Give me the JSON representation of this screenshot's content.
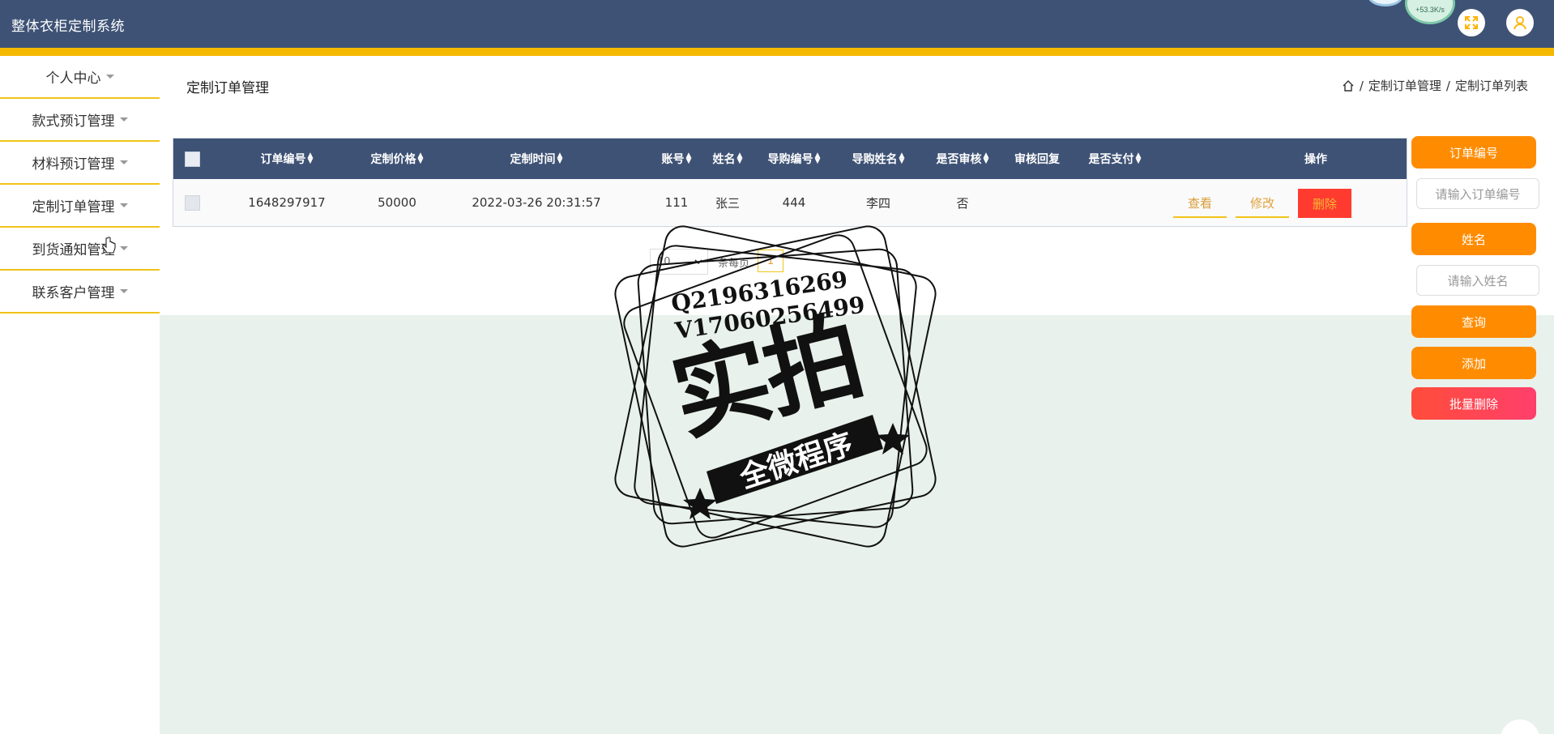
{
  "app": {
    "title": "整体衣柜定制系统"
  },
  "header": {
    "net_speed": "+53.3K/s"
  },
  "sidebar": {
    "items": [
      {
        "label": "个人中心"
      },
      {
        "label": "款式预订管理"
      },
      {
        "label": "材料预订管理"
      },
      {
        "label": "定制订单管理"
      },
      {
        "label": "到货通知管理"
      },
      {
        "label": "联系客户管理"
      }
    ]
  },
  "page": {
    "title": "定制订单管理"
  },
  "breadcrumb": {
    "items": [
      "定制订单管理",
      "定制订单列表"
    ],
    "separator": "/"
  },
  "table": {
    "columns": [
      "订单编号",
      "定制价格",
      "定制时间",
      "账号",
      "姓名",
      "导购编号",
      "导购姓名",
      "是否审核",
      "审核回复",
      "是否支付",
      "操作"
    ],
    "rows": [
      {
        "order_no": "1648297917",
        "price": "50000",
        "time": "2022-03-26 20:31:57",
        "account": "111",
        "name": "张三",
        "guide_no": "444",
        "guide_name": "李四",
        "reviewed": "否",
        "reply": "",
        "paid": ""
      }
    ],
    "actions": {
      "view": "查看",
      "edit": "修改",
      "delete": "删除"
    }
  },
  "pagination": {
    "page_size": "10",
    "per_page_label": "条每页",
    "current_page": "1"
  },
  "search": {
    "order_no_label": "订单编号",
    "order_no_placeholder": "请输入订单编号",
    "name_label": "姓名",
    "name_placeholder": "请输入姓名",
    "query_label": "查询",
    "add_label": "添加",
    "batch_delete_label": "批量删除"
  },
  "watermark": {
    "line1": "Q2196316269",
    "line2": "V17060256499",
    "main": "实拍",
    "banner": "全微程序"
  },
  "colors": {
    "header": "#3e5275",
    "accent": "#f5b800",
    "orange": "#ff8c00",
    "danger": "#ff3b30",
    "content_bg": "#e8f1ec"
  }
}
